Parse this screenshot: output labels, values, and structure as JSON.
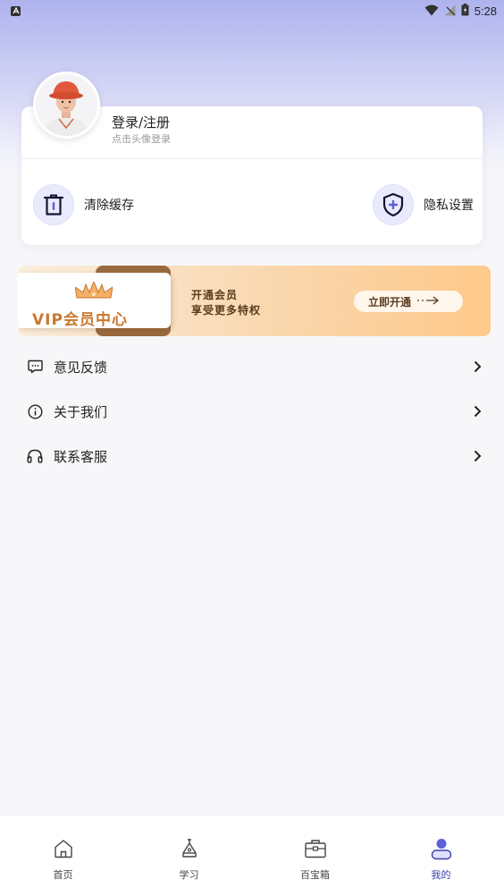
{
  "status_bar": {
    "time": "5:28",
    "icons": [
      "android-a-icon",
      "wifi-icon",
      "signal-off-icon",
      "battery-icon"
    ]
  },
  "profile": {
    "title": "登录/注册",
    "subtitle": "点击头像登录",
    "avatar_icon": "avatar-3d-character"
  },
  "quick_actions": [
    {
      "label": "清除缓存",
      "icon": "trash-icon"
    },
    {
      "label": "隐私设置",
      "icon": "shield-plus-icon"
    }
  ],
  "vip": {
    "card_title": "VIP会员中心",
    "line1": "开通会员",
    "line2": "享受更多特权",
    "button_label": "立即开通",
    "colors": {
      "accent": "#c9782f",
      "text": "#5b3c1e",
      "tab": "#9a6a3f"
    }
  },
  "menu": [
    {
      "label": "意见反馈",
      "icon": "chat-bubble-icon"
    },
    {
      "label": "关于我们",
      "icon": "info-circle-icon"
    },
    {
      "label": "联系客服",
      "icon": "headphones-icon"
    }
  ],
  "bottom_nav": {
    "items": [
      {
        "label": "首页",
        "icon": "home-icon"
      },
      {
        "label": "学习",
        "icon": "study-icon"
      },
      {
        "label": "百宝箱",
        "icon": "toolbox-icon"
      },
      {
        "label": "我的",
        "icon": "user-icon",
        "active": true
      }
    ],
    "active_color": "#3a3fa8"
  }
}
